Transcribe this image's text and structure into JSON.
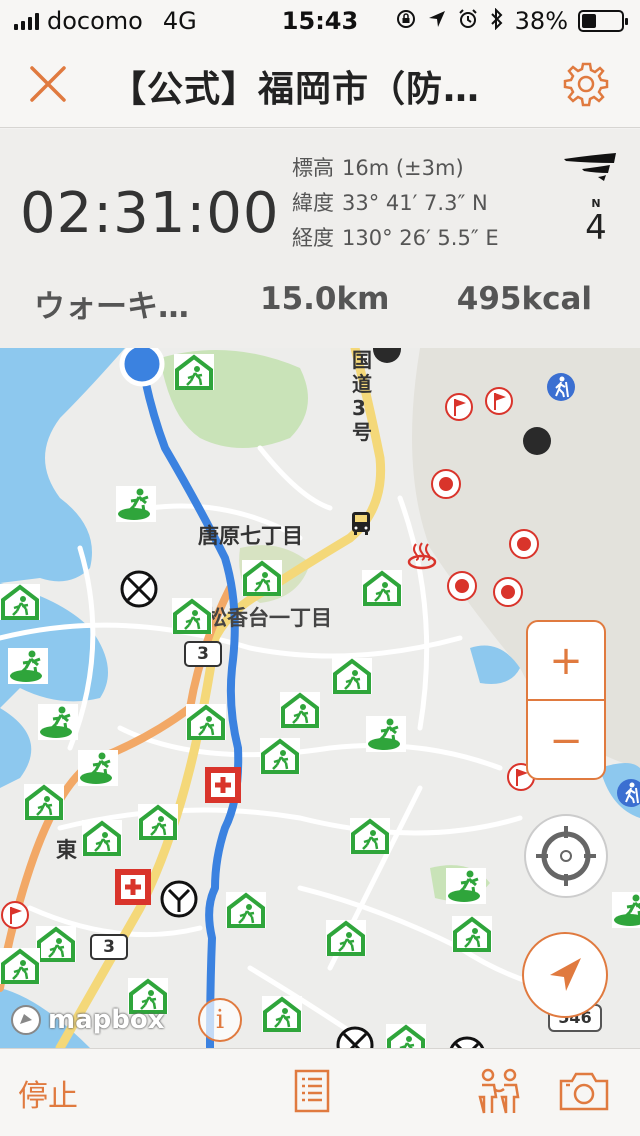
{
  "status_bar": {
    "carrier": "docomo",
    "network": "4G",
    "time": "15:43",
    "battery": "38%",
    "battery_level": 0.38,
    "icons": [
      "rotation-lock-icon",
      "location-arrow-icon",
      "alarm-icon",
      "bluetooth-icon"
    ]
  },
  "nav": {
    "title": "【公式】福岡市（防…",
    "close_icon": "close-icon",
    "settings_icon": "gear-icon"
  },
  "stats": {
    "elapsed": "02:31:00",
    "altitude_label": "標高",
    "altitude_value": "16m (±3m)",
    "latitude_label": "緯度",
    "latitude_value": "33° 41′ 7.3″ N",
    "longitude_label": "経度",
    "longitude_value": "130° 26′ 5.5″ E",
    "compass_north": "N",
    "compass_value": "4",
    "activity": "ウォーキ…",
    "distance": "15.0km",
    "calories": "495kcal"
  },
  "map": {
    "labels": {
      "town1": "唐原七丁目",
      "town2": "松香台一丁目",
      "east": "東",
      "road_vertical": "国道3号"
    },
    "route_shields": [
      "3",
      "3"
    ],
    "route_sign": "546",
    "attribution": "mapbox",
    "info": "i",
    "zoom_in": "+",
    "zoom_out": "−",
    "colors": {
      "accent": "#e07a3f",
      "route": "#3b82e0",
      "shelter": "#2fa53b",
      "water": "#8dc8ee",
      "park": "#c9e3b8",
      "hospital": "#d9342b"
    }
  },
  "bottom": {
    "stop": "停止",
    "log_icon": "list-icon",
    "people_icon": "people-icon",
    "camera_icon": "camera-icon"
  }
}
